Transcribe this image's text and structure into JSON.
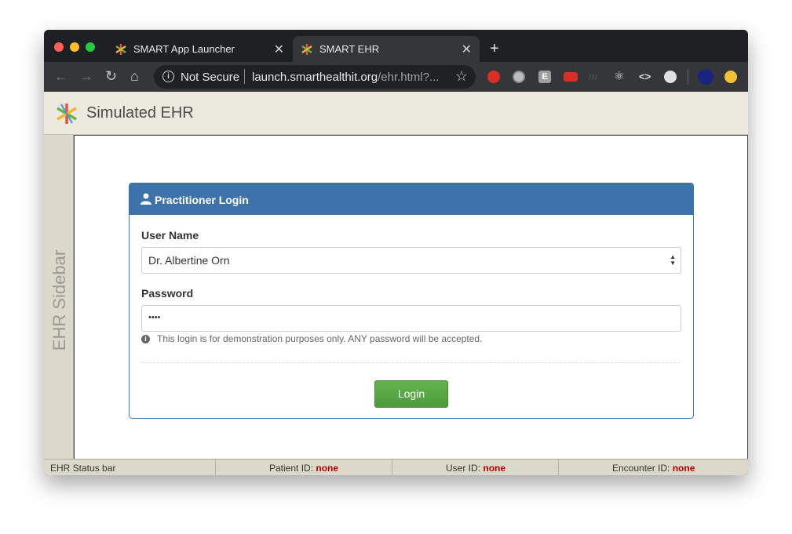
{
  "browser": {
    "tabs": [
      {
        "title": "SMART App Launcher",
        "active": false
      },
      {
        "title": "SMART EHR",
        "active": true
      }
    ],
    "new_tab": "+",
    "security_label": "Not Secure",
    "url_host": "launch.smarthealthit.org",
    "url_path": "/ehr.html?..."
  },
  "ehr": {
    "title": "Simulated EHR",
    "sidebar_label": "EHR Sidebar"
  },
  "login": {
    "heading": "Practitioner Login",
    "username_label": "User Name",
    "username_value": "Dr. Albertine Orn",
    "password_label": "Password",
    "password_value": "••••",
    "help_text": "This login is for demonstration purposes only. ANY password will be accepted.",
    "login_button": "Login"
  },
  "status": {
    "label": "EHR Status bar",
    "patient_label": "Patient ID:",
    "patient_value": "none",
    "user_label": "User ID:",
    "user_value": "none",
    "encounter_label": "Encounter ID:",
    "encounter_value": "none"
  },
  "colors": {
    "panel_heading": "#3d72ab",
    "login_button": "#5aa046",
    "status_none": "#b40000"
  }
}
